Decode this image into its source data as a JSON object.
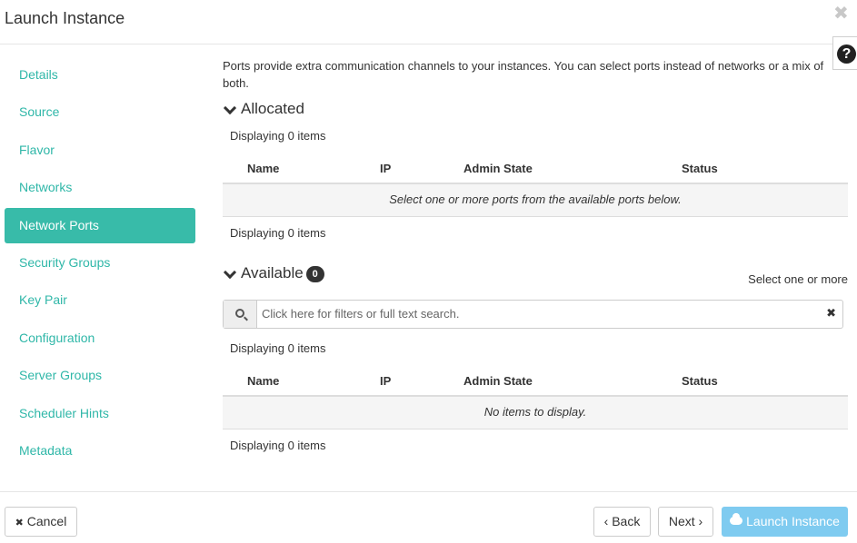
{
  "modal": {
    "title": "Launch Instance",
    "close_glyph": "✖",
    "help_glyph": "?"
  },
  "nav": {
    "items": [
      {
        "label": "Details",
        "active": false
      },
      {
        "label": "Source",
        "active": false
      },
      {
        "label": "Flavor",
        "active": false
      },
      {
        "label": "Networks",
        "active": false
      },
      {
        "label": "Network Ports",
        "active": true
      },
      {
        "label": "Security Groups",
        "active": false
      },
      {
        "label": "Key Pair",
        "active": false
      },
      {
        "label": "Configuration",
        "active": false
      },
      {
        "label": "Server Groups",
        "active": false
      },
      {
        "label": "Scheduler Hints",
        "active": false
      },
      {
        "label": "Metadata",
        "active": false
      }
    ]
  },
  "intro": "Ports provide extra communication channels to your instances. You can select ports instead of networks or a mix of both.",
  "allocated": {
    "title": "Allocated",
    "displaying_top": "Displaying 0 items",
    "columns": [
      "Name",
      "IP",
      "Admin State",
      "Status"
    ],
    "empty_message": "Select one or more ports from the available ports below.",
    "displaying_bottom": "Displaying 0 items"
  },
  "available": {
    "title": "Available",
    "count": "0",
    "select_note": "Select one or more",
    "search_placeholder": "Click here for filters or full text search.",
    "clear_glyph": "✖",
    "displaying_top": "Displaying 0 items",
    "columns": [
      "Name",
      "IP",
      "Admin State",
      "Status"
    ],
    "empty_message": "No items to display.",
    "displaying_bottom": "Displaying 0 items"
  },
  "footer": {
    "cancel_glyph": "✖",
    "cancel_label": "Cancel",
    "back_label": "‹ Back",
    "next_label": "Next ›",
    "launch_label": "Launch Instance"
  },
  "colors": {
    "accent": "#38bba9",
    "link": "#2fb7a8",
    "primary_button": "#7fcbf0"
  },
  "icons": [
    "close-icon",
    "help-icon",
    "chevron-down-icon",
    "search-icon",
    "clear-icon",
    "cloud-upload-icon"
  ]
}
